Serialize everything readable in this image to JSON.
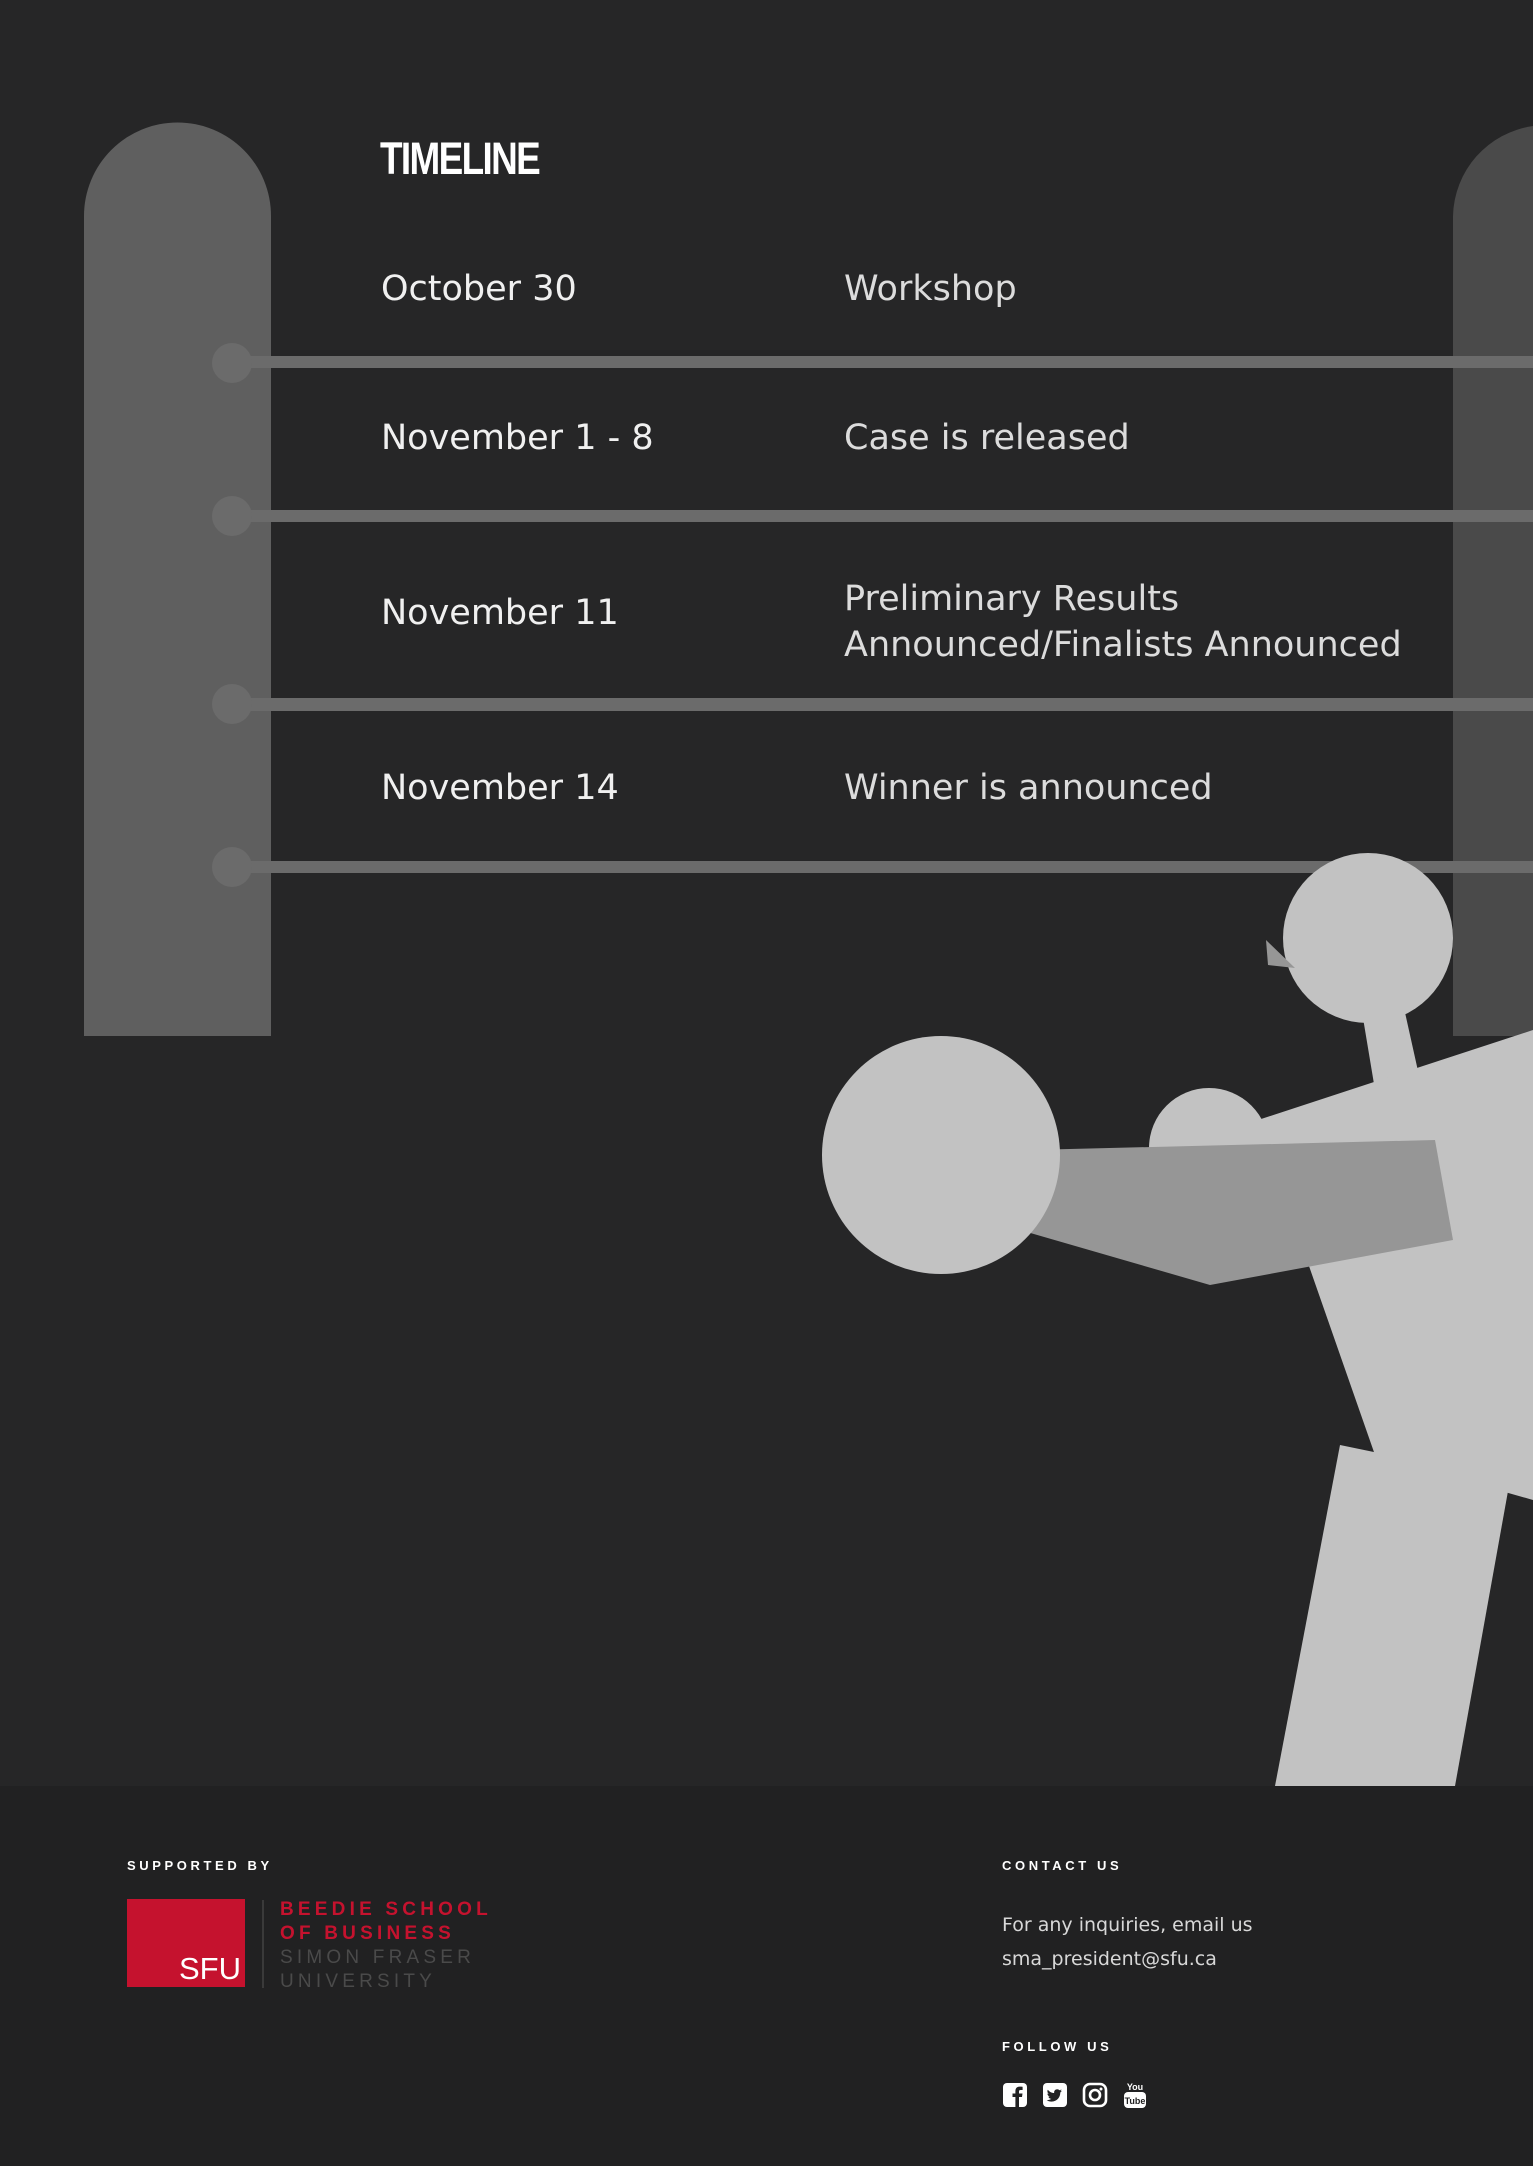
{
  "timeline": {
    "title": "TIMELINE",
    "items": [
      {
        "date": "October 30",
        "event": "Workshop"
      },
      {
        "date": "November 1 - 8",
        "event": "Case is released"
      },
      {
        "date": "November 11",
        "event_line1": "Preliminary Results",
        "event_line2": "Announced/Finalists Announced"
      },
      {
        "date": "November 14",
        "event": "Winner is announced"
      }
    ]
  },
  "footer": {
    "supported_by_label": "SUPPORTED BY",
    "logo": {
      "mark_text": "SFU",
      "line1": "BEEDIE SCHOOL",
      "line2": "OF BUSINESS",
      "line3": "SIMON FRASER",
      "line4": "UNIVERSITY"
    },
    "contact_label": "CONTACT US",
    "contact_line": "For any inquiries, email us",
    "contact_email": "sma_president@sfu.ca",
    "follow_label": "FOLLOW US",
    "social_icons": [
      "facebook-icon",
      "twitter-icon",
      "instagram-icon",
      "youtube-icon"
    ]
  },
  "colors": {
    "background": "#262627",
    "footer_background": "#212122",
    "post": "#5f5f5f",
    "rope": "#6b6b6b",
    "figure": "#c2c2c2",
    "arm": "#969696",
    "accent_red": "#c5122e"
  }
}
